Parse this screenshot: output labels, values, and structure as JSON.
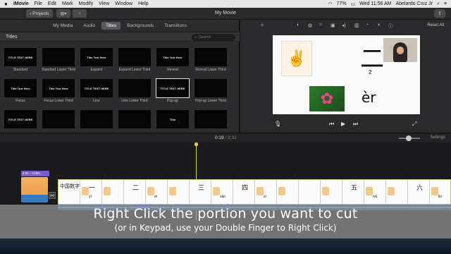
{
  "menubar": {
    "apple": "",
    "app": "iMovie",
    "items": [
      "File",
      "Edit",
      "Mark",
      "Modify",
      "View",
      "Window",
      "Help"
    ],
    "battery": "77%",
    "clock": "Wed 11:56 AM",
    "user": "Abelardo Cruz Jr"
  },
  "toolbar": {
    "projects_label": "Projects",
    "window_title": "My Movie"
  },
  "browser": {
    "tabs": [
      "My Media",
      "Audio",
      "Titles",
      "Backgrounds",
      "Transitions"
    ],
    "active_tab": "Titles",
    "section_label": "Titles",
    "search_placeholder": "Search",
    "tiles": [
      {
        "thumb": "TITLE TEXT HERE",
        "label": "Standard"
      },
      {
        "thumb": "",
        "label": "Standard Lower Third"
      },
      {
        "thumb": "Title Text Here",
        "label": "Expand"
      },
      {
        "thumb": "",
        "label": "Expand Lower Third"
      },
      {
        "thumb": "Title Text Here",
        "label": "Reveal"
      },
      {
        "thumb": "",
        "label": "Reveal Lower Third"
      },
      {
        "thumb": "Title Text Here",
        "label": "Focus"
      },
      {
        "thumb": "Title Text Here",
        "label": "Focus Lower Third"
      },
      {
        "thumb": "TITLE TEXT HERE",
        "label": "Line"
      },
      {
        "thumb": "",
        "label": "Line Lower Third"
      },
      {
        "thumb": "TITLE TEXT HERE",
        "label": "Pop-up"
      },
      {
        "thumb": "",
        "label": "Pop-up Lower Third"
      },
      {
        "thumb": "TITLE TEXT HERE",
        "label": ""
      },
      {
        "thumb": "",
        "label": ""
      },
      {
        "thumb": "",
        "label": ""
      },
      {
        "thumb": "",
        "label": ""
      },
      {
        "thumb": "Title",
        "label": ""
      },
      {
        "thumb": "",
        "label": ""
      }
    ]
  },
  "viewer": {
    "reset_label": "Reset All",
    "slide": {
      "hanzi": "二",
      "number": "2",
      "pinyin": "èr"
    }
  },
  "timeline": {
    "current_time": "0:19",
    "total_time": "2:31",
    "settings_label": "Settings",
    "title_clip_label": "2.5s – CHIN…",
    "frames": [
      {
        "hz": "中国数字",
        "py": ""
      },
      {
        "hz": "一",
        "py": "yī"
      },
      {
        "hz": "",
        "py": ""
      },
      {
        "hz": "二",
        "py": ""
      },
      {
        "hz": "",
        "py": "èr"
      },
      {
        "hz": "",
        "py": ""
      },
      {
        "hz": "三",
        "py": ""
      },
      {
        "hz": "",
        "py": "sān"
      },
      {
        "hz": "四",
        "py": ""
      },
      {
        "hz": "",
        "py": "sì"
      },
      {
        "hz": "",
        "py": ""
      },
      {
        "hz": "",
        "py": ""
      },
      {
        "hz": "",
        "py": ""
      },
      {
        "hz": "五",
        "py": ""
      },
      {
        "hz": "",
        "py": "wǔ"
      },
      {
        "hz": "",
        "py": ""
      },
      {
        "hz": "六",
        "py": ""
      },
      {
        "hz": "",
        "py": "liù"
      }
    ]
  },
  "caption": {
    "line1": "Right Click the portion you want to cut",
    "line2": "(or in  Keypad, use your Double Finger to Right Click)"
  }
}
